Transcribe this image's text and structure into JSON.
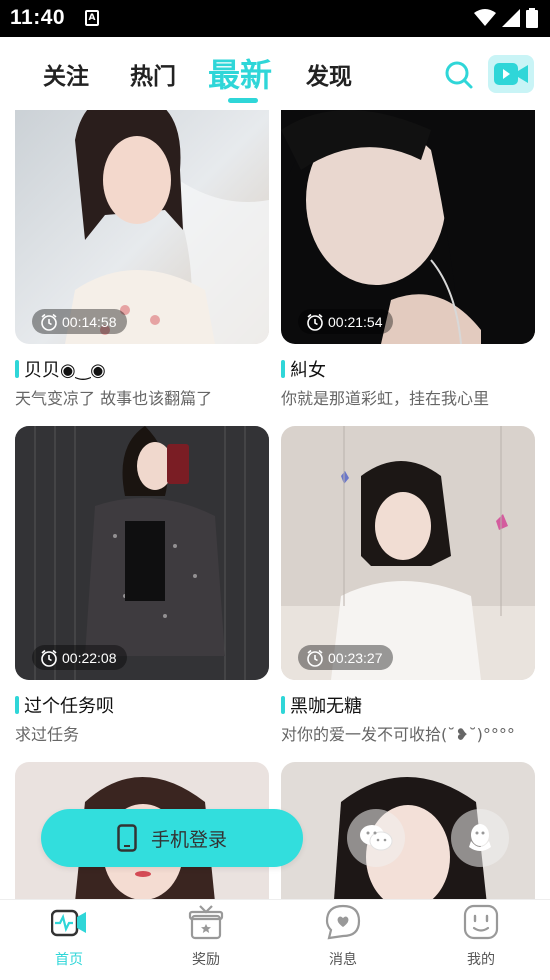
{
  "status_bar": {
    "time": "11:40",
    "app_icon_letter": "A",
    "icons": [
      "wifi-icon",
      "signal-icon",
      "battery-icon"
    ]
  },
  "top_tabs": [
    {
      "label": "关注",
      "active": false
    },
    {
      "label": "热门",
      "active": false
    },
    {
      "label": "最新",
      "active": true
    },
    {
      "label": "发现",
      "active": false
    }
  ],
  "header_icons": {
    "search": "search-icon",
    "video": "video-camera-icon"
  },
  "colors": {
    "accent": "#2fd6d8",
    "login_button": "#32dedd"
  },
  "feed": [
    {
      "duration": "00:14:58",
      "name": "贝贝◉‿◉",
      "description": "天气变凉了 故事也该翻篇了"
    },
    {
      "duration": "00:21:54",
      "name": "糾女",
      "description": "你就是那道彩虹，挂在我心里"
    },
    {
      "duration": "00:22:08",
      "name": "过个任务呗",
      "description": "求过任务"
    },
    {
      "duration": "00:23:27",
      "name": "黑咖无糖",
      "description": "对你的爱一发不可收拾(˘❥˘)°°°°"
    }
  ],
  "login_button": {
    "label": "手机登录",
    "icon": "phone-icon"
  },
  "quick_login": [
    "wechat-icon",
    "qq-icon"
  ],
  "bottom_nav": [
    {
      "label": "首页",
      "icon": "home-video-icon",
      "active": true
    },
    {
      "label": "奖励",
      "icon": "gift-icon",
      "active": false
    },
    {
      "label": "消息",
      "icon": "message-icon",
      "active": false
    },
    {
      "label": "我的",
      "icon": "profile-icon",
      "active": false
    }
  ]
}
